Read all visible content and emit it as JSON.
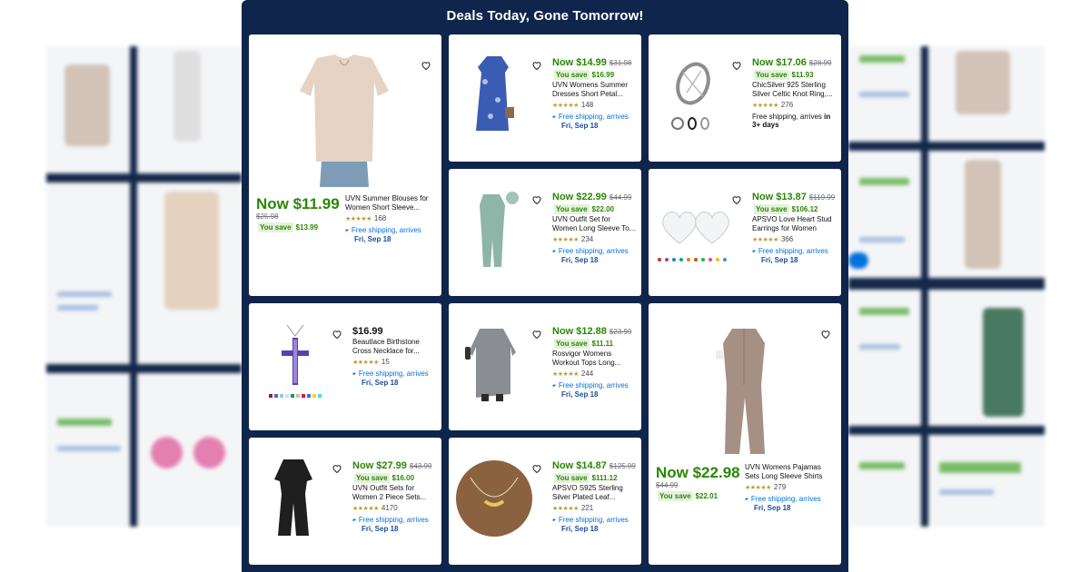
{
  "modal": {
    "title": "Deals Today, Gone Tomorrow!"
  },
  "products": [
    {
      "id": "p1",
      "price": "Now $11.99",
      "was": "$25.98",
      "save_label": "You save",
      "save_amount": "$13.99",
      "title": "UVN Summer Blouses for Women Short Sleeve...",
      "rating_count": "168",
      "shipping": "Free shipping, arrives",
      "arrival": "Fri, Sep 18"
    },
    {
      "id": "p2",
      "price": "Now $14.99",
      "was": "$31.98",
      "save_label": "You save",
      "save_amount": "$16.99",
      "title": "UVN Womens Summer Dresses Short Petal...",
      "rating_count": "148",
      "shipping": "Free shipping, arrives",
      "arrival": "Fri, Sep 18"
    },
    {
      "id": "p3",
      "price": "Now $17.06",
      "was": "$28.99",
      "save_label": "You save",
      "save_amount": "$11.93",
      "title": "ChicSilver 925 Sterling Silver Celtic Knot Ring,...",
      "rating_count": "276",
      "shipping": "Free shipping, arrives",
      "arrival_bold": "in 3+ days"
    },
    {
      "id": "p4",
      "price": "Now $22.99",
      "was": "$44.99",
      "save_label": "You save",
      "save_amount": "$22.00",
      "title": "UVN Outfit Set for Women Long Sleeve To...",
      "rating_count": "234",
      "shipping": "Free shipping, arrives",
      "arrival": "Fri, Sep 18"
    },
    {
      "id": "p5",
      "price": "Now $13.87",
      "was": "$119.99",
      "save_label": "You save",
      "save_amount": "$106.12",
      "title": "APSVO Love Heart Stud Earrings for Women Girl...",
      "rating_count": "366",
      "shipping": "Free shipping, arrives",
      "arrival": "Fri, Sep 18"
    },
    {
      "id": "p6",
      "price": "$16.99",
      "title": "Beautlace Birthstone Cross Necklace for...",
      "rating_count": "15",
      "shipping": "Free shipping, arrives",
      "arrival": "Fri, Sep 18"
    },
    {
      "id": "p7",
      "price": "Now $12.88",
      "was": "$23.99",
      "save_label": "You save",
      "save_amount": "$11.11",
      "title": "Rosvigor Womens Workout Tops Long...",
      "rating_count": "244",
      "shipping": "Free shipping, arrives",
      "arrival": "Fri, Sep 18"
    },
    {
      "id": "p8",
      "price": "Now $22.98",
      "was": "$44.99",
      "save_label": "You save",
      "save_amount": "$22.01",
      "title": "UVN Womens Pajamas Sets Long Sleeve Shirts and...",
      "rating_count": "279",
      "shipping": "Free shipping, arrives",
      "arrival": "Fri, Sep 18"
    },
    {
      "id": "p9",
      "price": "Now $27.99",
      "was": "$43.99",
      "save_label": "You save",
      "save_amount": "$16.00",
      "title": "UVN Outfit Sets for Women 2 Piece Sets...",
      "rating_count": "4170",
      "shipping": "Free shipping, arrives",
      "arrival": "Fri, Sep 18"
    },
    {
      "id": "p10",
      "price": "Now $14.87",
      "was": "$125.99",
      "save_label": "You save",
      "save_amount": "$111.12",
      "title": "APSVO S925 Sterling Silver Plated Leaf...",
      "rating_count": "221",
      "shipping": "Free shipping, arrives",
      "arrival": "Fri, Sep 18"
    }
  ],
  "icons": {
    "favorite": "heart-outline-icon",
    "rating": "star-rating-icon",
    "shipping": "delivery-icon"
  },
  "colors": {
    "modal_bg": "#0f254c",
    "price_green": "#2a8703",
    "link_blue": "#0071dc"
  }
}
